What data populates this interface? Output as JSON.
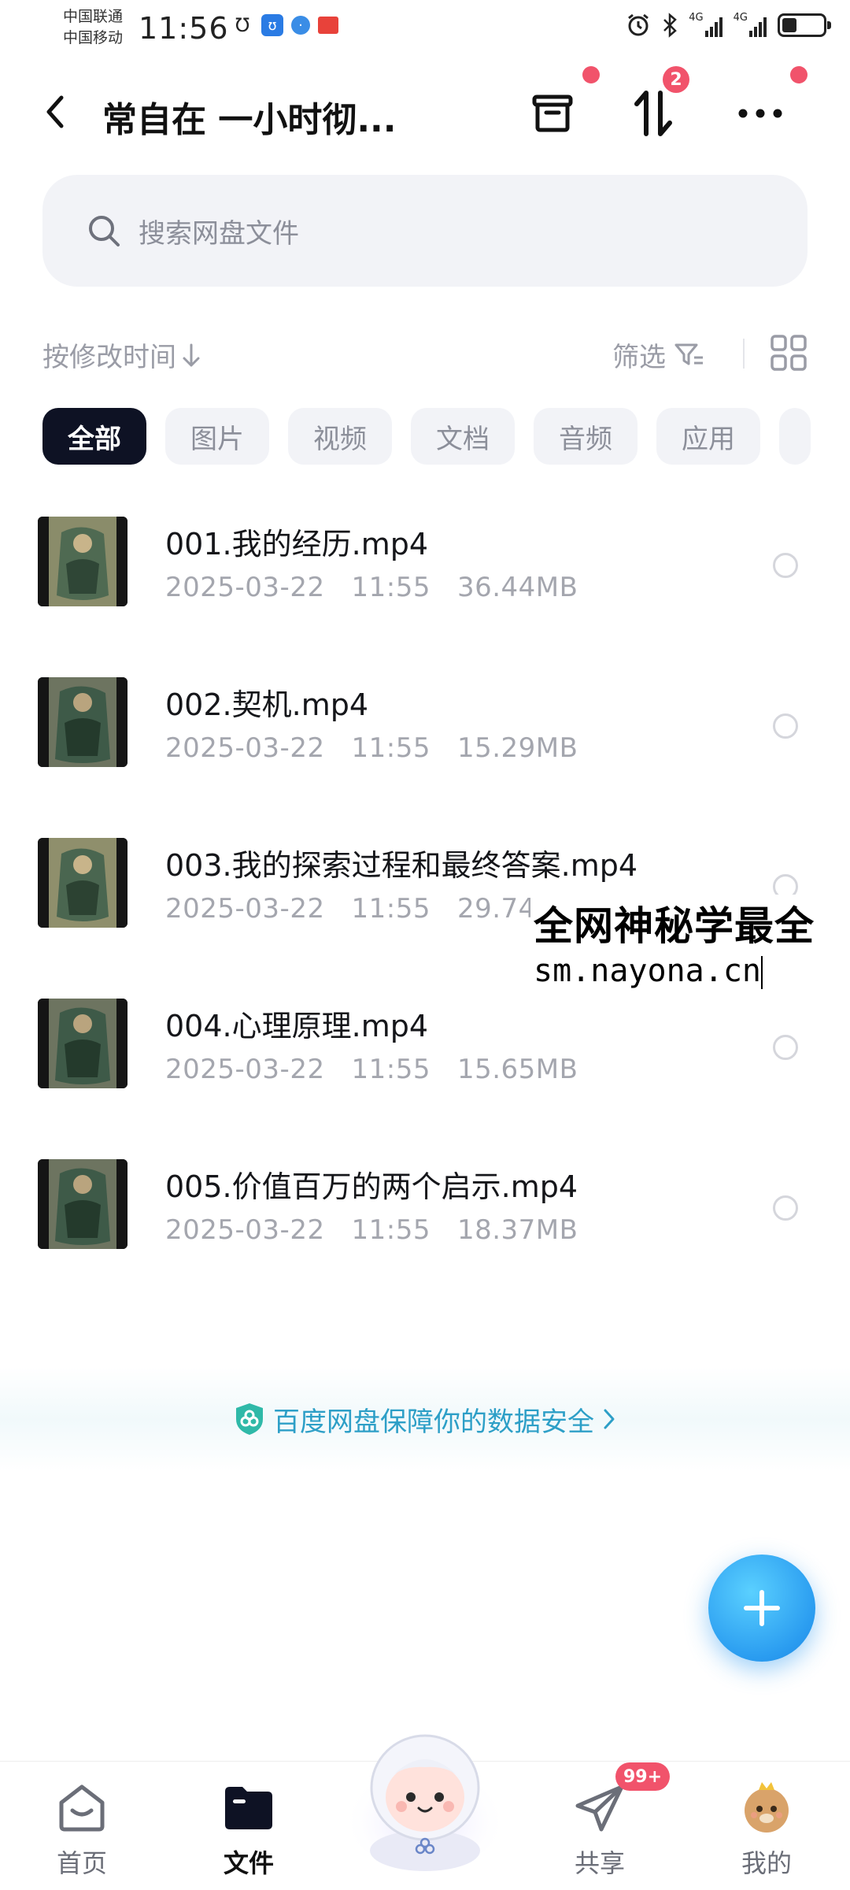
{
  "status_bar": {
    "carrier_1": "中国联通",
    "carrier_2": "中国移动",
    "time": "11:56",
    "network_1": "4G",
    "network_2": "4G"
  },
  "header": {
    "title": "常自在 一小时彻...",
    "transfer_badge": "2"
  },
  "search": {
    "placeholder": "搜索网盘文件"
  },
  "sort": {
    "label": "按修改时间",
    "filter_label": "筛选"
  },
  "chips": [
    "全部",
    "图片",
    "视频",
    "文档",
    "音频",
    "应用"
  ],
  "files": [
    {
      "name": "001.我的经历.mp4",
      "date": "2025-03-22",
      "time": "11:55",
      "size": "36.44MB"
    },
    {
      "name": "002.契机.mp4",
      "date": "2025-03-22",
      "time": "11:55",
      "size": "15.29MB"
    },
    {
      "name": "003.我的探索过程和最终答案.mp4",
      "date": "2025-03-22",
      "time": "11:55",
      "size": "29.74MB"
    },
    {
      "name": "004.心理原理.mp4",
      "date": "2025-03-22",
      "time": "11:55",
      "size": "15.65MB"
    },
    {
      "name": "005.价值百万的两个启示.mp4",
      "date": "2025-03-22",
      "time": "11:55",
      "size": "18.37MB"
    }
  ],
  "watermark": {
    "line1": "全网神秘学最全",
    "line2": "sm.nayona.cn"
  },
  "banner": {
    "text": "百度网盘保障你的数据安全"
  },
  "bottom_nav": {
    "home": "首页",
    "files": "文件",
    "share": "共享",
    "share_badge": "99+",
    "mine": "我的"
  },
  "colors": {
    "accent_blue": "#2a9cf0",
    "badge_red": "#f1536b",
    "chip_active": "#0e1224",
    "banner_text": "#2d9fc7"
  }
}
